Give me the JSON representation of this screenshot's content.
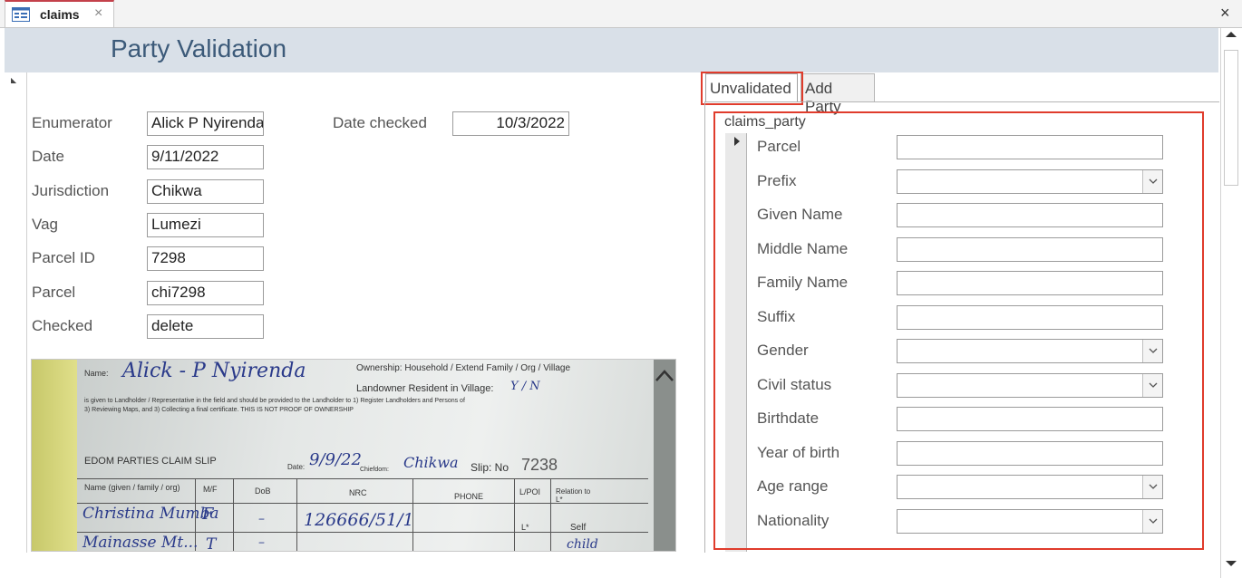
{
  "tab": {
    "label": "claims",
    "close": "×"
  },
  "window": {
    "close": "×"
  },
  "form": {
    "title": "Party Validation"
  },
  "fields": {
    "enumerator": {
      "label": "Enumerator",
      "value": "Alick P Nyirenda"
    },
    "date": {
      "label": "Date",
      "value": "9/11/2022"
    },
    "jurisdiction": {
      "label": "Jurisdiction",
      "value": "Chikwa"
    },
    "vag": {
      "label": "Vag",
      "value": "Lumezi"
    },
    "parcel_id": {
      "label": "Parcel ID",
      "value": "7298"
    },
    "parcel": {
      "label": "Parcel",
      "value": "chi7298"
    },
    "checked": {
      "label": "Checked",
      "value": "delete"
    },
    "date_checked": {
      "label": "Date checked",
      "value": "10/3/2022"
    }
  },
  "scan": {
    "name_label": "Name:",
    "name_hand": "Alick - P Nyirenda",
    "ownership": "Ownership: Household / Extend Family / Org / Village",
    "resident": "Landowner Resident in Village:",
    "resident_choice": "Y / N",
    "notice1": "is given to Landholder / Representative in the field and should be provided to the Landholder to 1) Register Landholders and Persons of",
    "notice2": "3) Reviewing Maps, and 3) Collecting a final certificate. THIS IS NOT PROOF OF OWNERSHIP",
    "slip_title": "EDOM PARTIES CLAIM SLIP",
    "date_label": "Date:",
    "date_hand": "9/9/22",
    "chiefdom_label": "Chiefdom:",
    "chiefdom_hand": "Chikwa",
    "slip_label": "Slip: No",
    "slip_no": "7238",
    "col_name": "Name (given / family / org)",
    "col_mf": "M/F",
    "col_dob": "DoB",
    "col_nrc": "NRC",
    "col_phone": "PHONE",
    "col_lpoi": "L/POI",
    "col_relation": "Relation to L*",
    "row1_name": "Christina Mumba",
    "row1_mf": "F",
    "row1_dob": "–",
    "row1_nrc": "126666/51/1",
    "row1_lpoi": "L*",
    "row1_rel": "Self",
    "row2_name": "Mainasse Mt...",
    "row2_mf": "T",
    "row2_dob": "–",
    "row2_rel": "child"
  },
  "right_tabs": {
    "unvalidated": "Unvalidated",
    "add_party": "Add Party"
  },
  "subform": {
    "title": "claims_party",
    "fields": [
      {
        "label": "Parcel",
        "type": "text",
        "value": ""
      },
      {
        "label": "Prefix",
        "type": "combo",
        "value": ""
      },
      {
        "label": "Given Name",
        "type": "text",
        "value": ""
      },
      {
        "label": "Middle Name",
        "type": "text",
        "value": ""
      },
      {
        "label": "Family Name",
        "type": "text",
        "value": ""
      },
      {
        "label": "Suffix",
        "type": "text",
        "value": ""
      },
      {
        "label": "Gender",
        "type": "combo",
        "value": ""
      },
      {
        "label": "Civil status",
        "type": "combo",
        "value": ""
      },
      {
        "label": "Birthdate",
        "type": "text",
        "value": ""
      },
      {
        "label": "Year of birth",
        "type": "text",
        "value": ""
      },
      {
        "label": "Age range",
        "type": "combo",
        "value": ""
      },
      {
        "label": "Nationality",
        "type": "combo",
        "value": ""
      }
    ]
  },
  "icons": {
    "form": "form-icon",
    "combo": "chevron-down-icon",
    "scroll_up": "chevron-up-icon"
  },
  "colors": {
    "highlight": "#e03c2c",
    "title": "#3c5a79",
    "header_band": "#d9e0e8",
    "tab_accent": "#c4414b"
  }
}
